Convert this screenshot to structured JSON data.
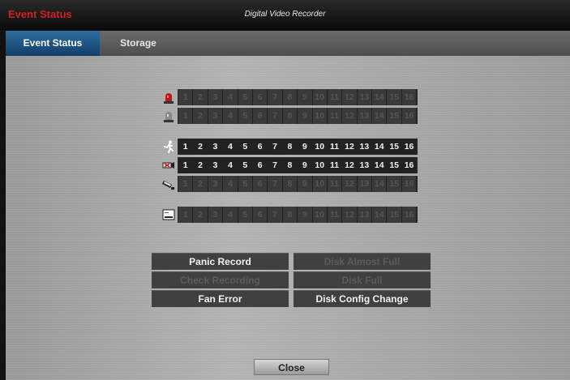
{
  "window": {
    "title": "Event Status",
    "subtitle": "Digital Video Recorder"
  },
  "tabs": [
    {
      "label": "Event Status",
      "active": true
    },
    {
      "label": "Storage",
      "active": false
    }
  ],
  "channel_numbers": [
    "1",
    "2",
    "3",
    "4",
    "5",
    "6",
    "7",
    "8",
    "9",
    "10",
    "11",
    "12",
    "13",
    "14",
    "15",
    "16"
  ],
  "event_rows": [
    {
      "icon": "alarm-siren-icon",
      "active": false
    },
    {
      "icon": "alarm-out-icon",
      "active": false
    },
    {
      "icon": "motion-icon",
      "active": true
    },
    {
      "icon": "video-loss-icon",
      "active": true
    },
    {
      "icon": "tamper-camera-icon",
      "active": false
    },
    {
      "icon": "text-input-icon",
      "active": false
    }
  ],
  "system_events": [
    {
      "label": "Panic Record",
      "active": true
    },
    {
      "label": "Disk Almost Full",
      "active": false
    },
    {
      "label": "Check Recording",
      "active": false
    },
    {
      "label": "Disk Full",
      "active": false
    },
    {
      "label": "Fan Error",
      "active": true
    },
    {
      "label": "Disk Config Change",
      "active": true
    }
  ],
  "close_label": "Close",
  "colors": {
    "title_red": "#d81e1e",
    "tab_active": "#1f5a8c"
  }
}
